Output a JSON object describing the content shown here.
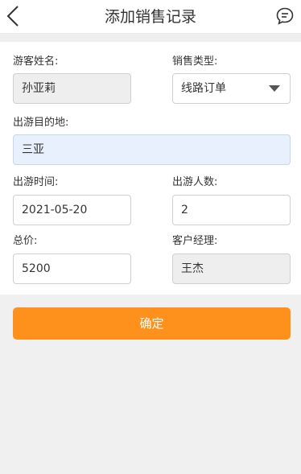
{
  "header": {
    "title": "添加销售记录",
    "back_icon": "chevron-left-icon",
    "message_icon": "chat-bubble-icon"
  },
  "form": {
    "tourist_name": {
      "label": "游客姓名:",
      "value": "孙亚莉"
    },
    "sale_type": {
      "label": "销售类型:",
      "value": "线路订单"
    },
    "destination": {
      "label": "出游目的地:",
      "value": "三亚"
    },
    "travel_date": {
      "label": "出游时间:",
      "value": "2021-05-20"
    },
    "people_count": {
      "label": "出游人数:",
      "value": "2"
    },
    "total_price": {
      "label": "总价:",
      "value": "5200"
    },
    "account_manager": {
      "label": "客户经理:",
      "value": "王杰"
    }
  },
  "actions": {
    "confirm_label": "确定"
  },
  "colors": {
    "accent": "#fe911c",
    "readonly_bg": "#eeeeee",
    "active_field_bg": "#e8f0fe",
    "page_bg": "#f0f0f0"
  }
}
